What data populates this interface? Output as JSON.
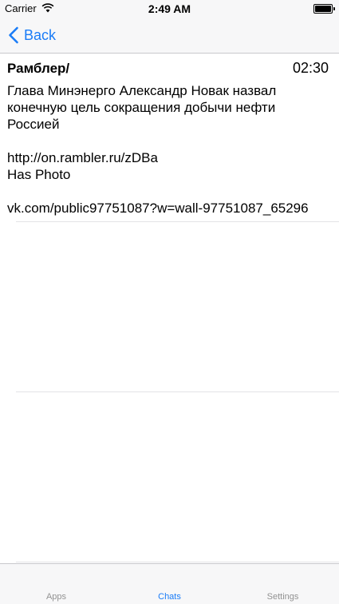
{
  "status_bar": {
    "carrier": "Carrier",
    "time": "2:49 AM"
  },
  "nav": {
    "back_label": "Back"
  },
  "message": {
    "sender": "Рамблер/",
    "time": "02:30",
    "lines": [
      "Глава Минэнерго Александр Новак назвал",
      "конечную цель сокращения добычи нефти",
      "Россией",
      "",
      "http://on.rambler.ru/zDBa",
      "Has Photo",
      "",
      "vk.com/public97751087?w=wall-97751087_65296"
    ]
  },
  "tabs": [
    {
      "label": "Apps",
      "active": false
    },
    {
      "label": "Chats",
      "active": true
    },
    {
      "label": "Settings",
      "active": false
    }
  ],
  "colors": {
    "accent": "#1a7cf7",
    "inactive_tab": "#929292",
    "bar_background": "#f7f7f8"
  }
}
